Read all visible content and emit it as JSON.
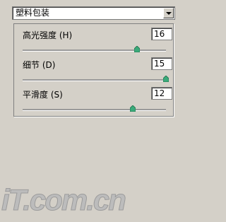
{
  "preset": {
    "selected": "塑料包装"
  },
  "sliders": [
    {
      "label": "高光强度 (H)",
      "value": "16",
      "level": 0.8
    },
    {
      "label": "细节 (D)",
      "value": "15",
      "level": 1.0
    },
    {
      "label": "平滑度 (S)",
      "value": "12",
      "level": 0.77
    }
  ],
  "colors": {
    "background": "#d4d0c8",
    "thumb": "#3aaa7a"
  },
  "watermark": "iT.com.cn"
}
